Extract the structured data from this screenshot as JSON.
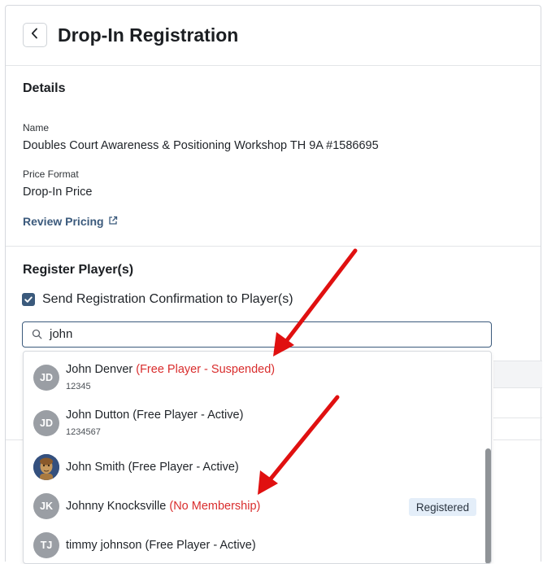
{
  "header": {
    "title": "Drop-In Registration",
    "back_icon": "chevron-left-icon"
  },
  "details": {
    "title": "Details",
    "name_label": "Name",
    "name_value": "Doubles Court Awareness & Positioning Workshop TH 9A #1586695",
    "price_format_label": "Price Format",
    "price_format_value": "Drop-In Price",
    "review_pricing_label": "Review Pricing",
    "review_pricing_icon": "external-link-icon"
  },
  "register": {
    "title": "Register Player(s)",
    "send_confirmation_label": "Send Registration Confirmation to Player(s)",
    "send_confirmation_checked": true,
    "search": {
      "value": "john",
      "icon": "search-icon"
    }
  },
  "results": [
    {
      "initials": "JD",
      "name": "John Denver",
      "status": "(Free Player - Suspended)",
      "status_color": "#d92d2d",
      "id": "12345",
      "badge": ""
    },
    {
      "initials": "JD",
      "name": "John Dutton",
      "status": "(Free Player - Active)",
      "status_color": "#1f2328",
      "id": "1234567",
      "badge": ""
    },
    {
      "initials": "",
      "name": "John Smith",
      "status": "(Free Player - Active)",
      "status_color": "#1f2328",
      "id": "",
      "badge": "",
      "avatar": "photo"
    },
    {
      "initials": "JK",
      "name": "Johnny Knocksville",
      "status": "(No Membership)",
      "status_color": "#d92d2d",
      "id": "",
      "badge": "Registered"
    },
    {
      "initials": "TJ",
      "name": "timmy johnson",
      "status": "(Free Player - Active)",
      "status_color": "#1f2328",
      "id": "",
      "badge": ""
    }
  ],
  "colors": {
    "accent": "#3b5a7c",
    "warning": "#d92d2d",
    "annotation_arrow": "#e01010",
    "badge_bg": "#e4eef9"
  }
}
